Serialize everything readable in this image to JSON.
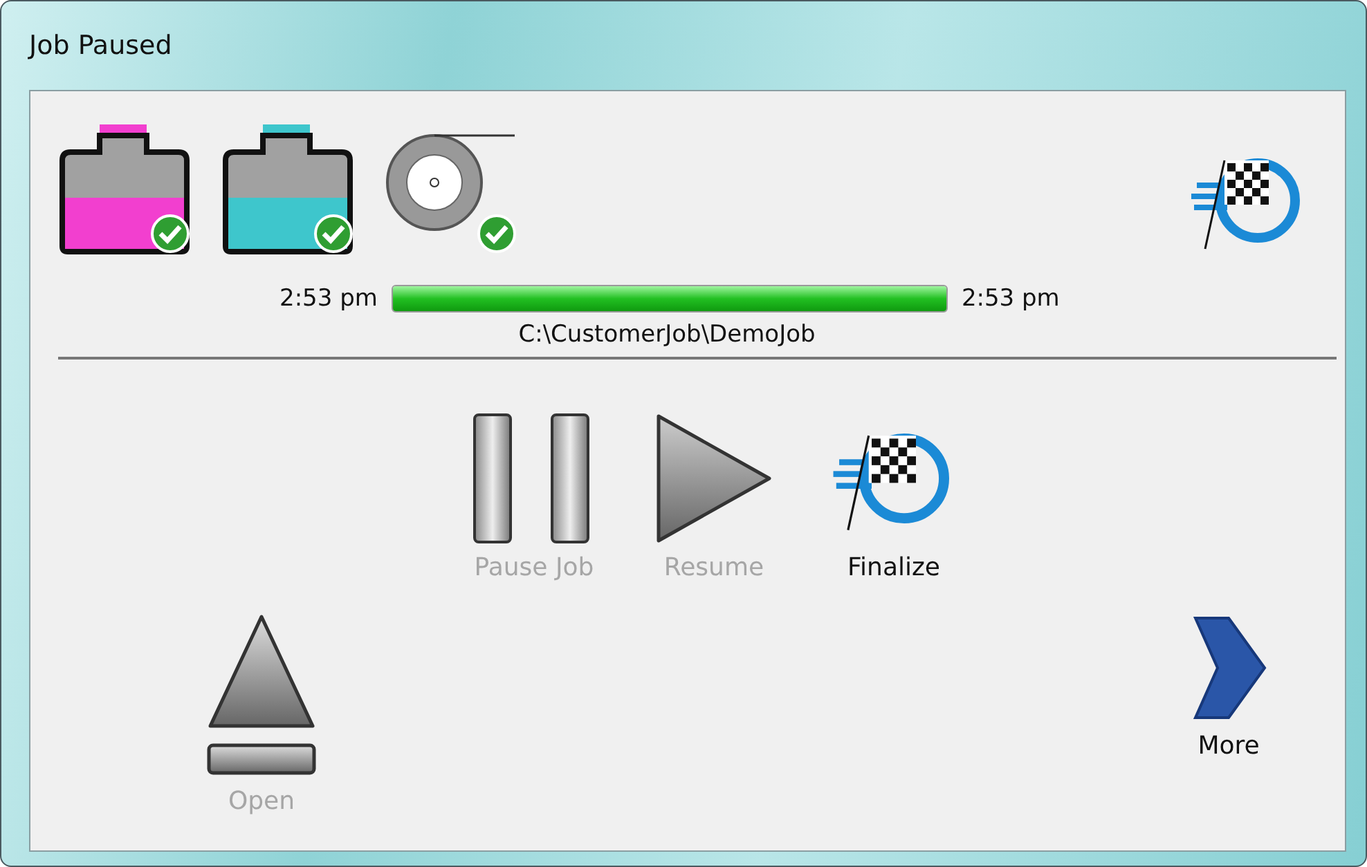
{
  "window": {
    "title": "Job Paused"
  },
  "supplies": [
    {
      "kind": "ink",
      "color": "#f23fcf",
      "ok": true
    },
    {
      "kind": "ink",
      "color": "#3ec6cc",
      "ok": true
    },
    {
      "kind": "media",
      "ok": true
    }
  ],
  "progress": {
    "start": "2:53 pm",
    "level": 1,
    "end": "2:53 pm",
    "path": "C:\\CustomerJob\\DemoJob"
  },
  "actions": [
    {
      "kind": "pause",
      "label": "Pause Job",
      "disabled": true
    },
    {
      "kind": "play",
      "label": "Resume",
      "disabled": true
    },
    {
      "kind": "flag",
      "label": "Finalize",
      "disabled": false
    }
  ],
  "bottom_actions": [
    {
      "kind": "eject",
      "label": "Open",
      "disabled": true
    },
    {
      "kind": "more",
      "label": "More",
      "disabled": false
    }
  ]
}
